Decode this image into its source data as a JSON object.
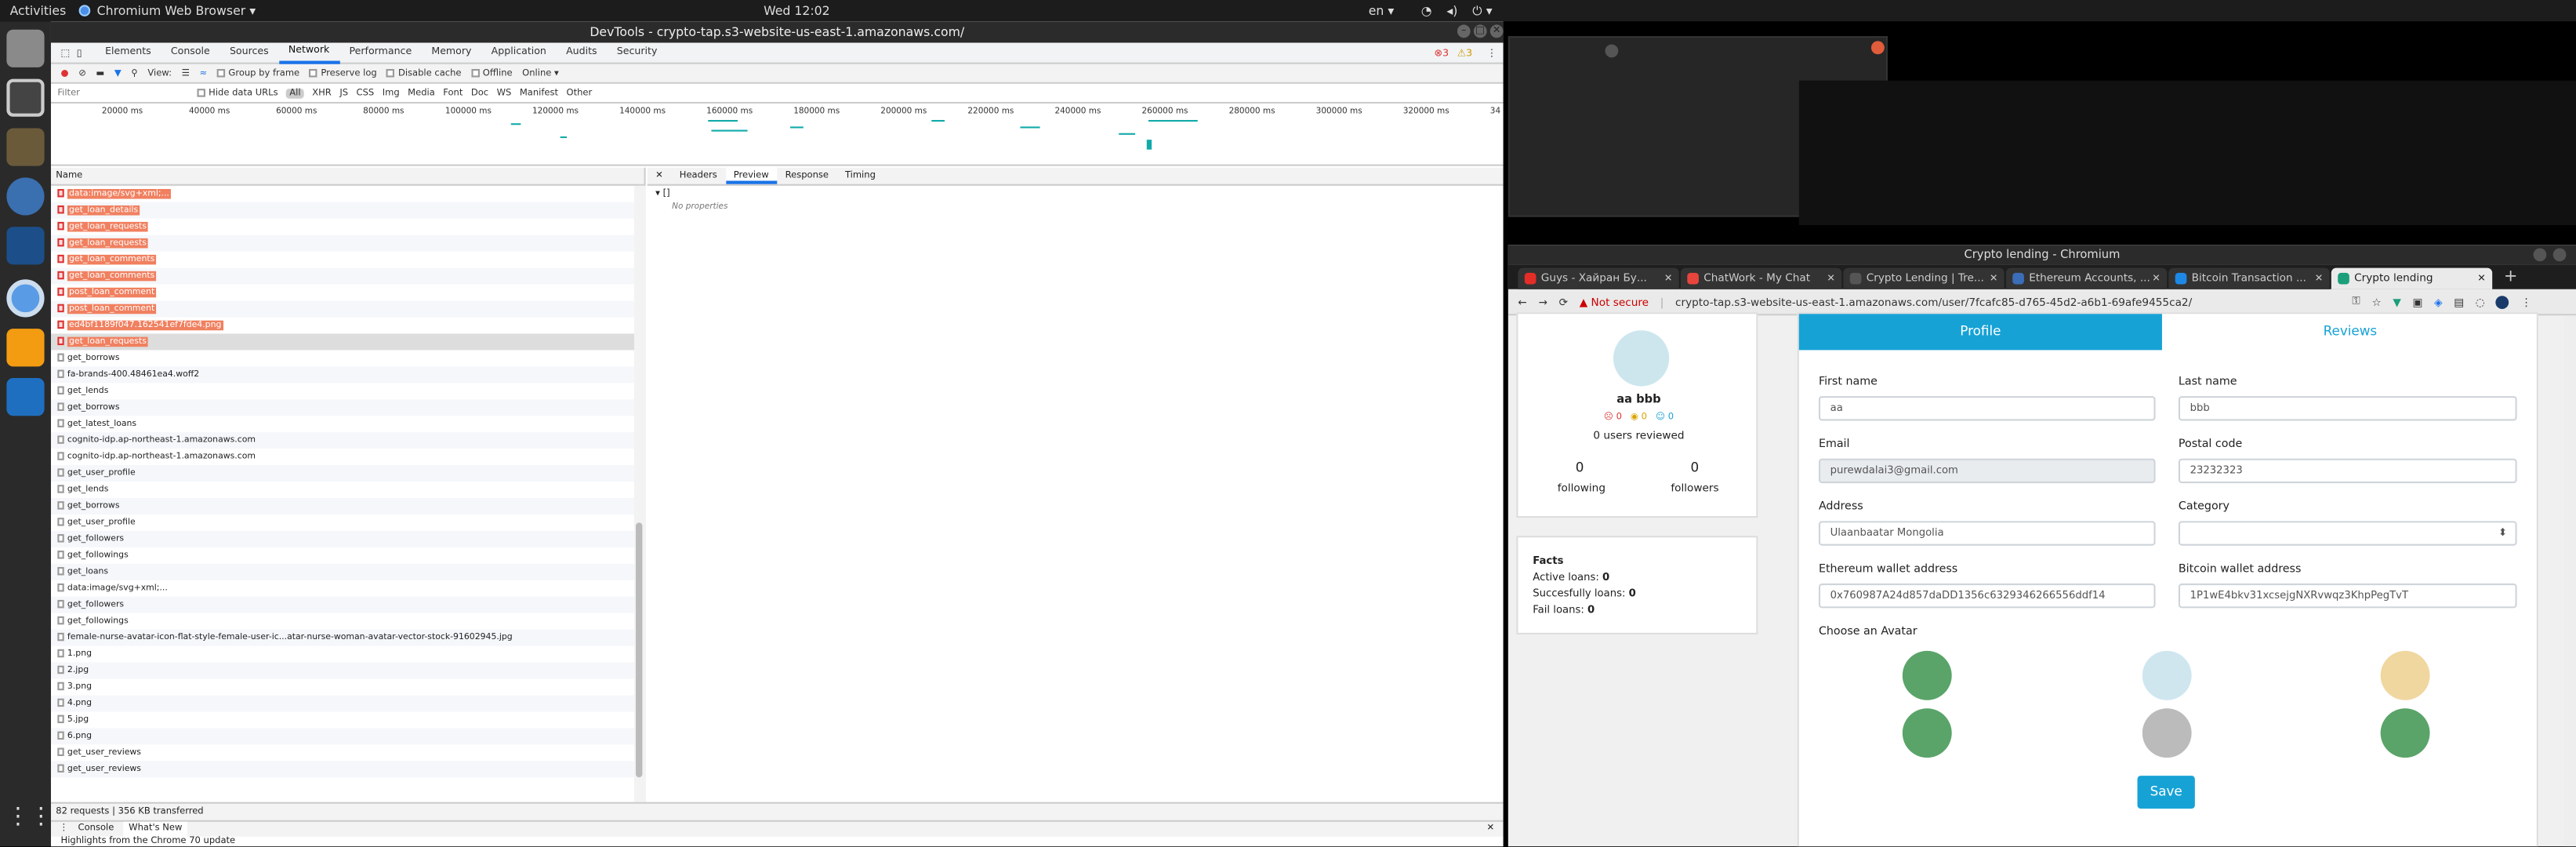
{
  "topbar": {
    "activities": "Activities",
    "app": "Chromium Web Browser ▾",
    "clock": "Wed 12:02",
    "lang": "en ▾"
  },
  "devtools": {
    "title": "DevTools - crypto-tap.s3-website-us-east-1.amazonaws.com/",
    "tabs": [
      "Elements",
      "Console",
      "Sources",
      "Network",
      "Performance",
      "Memory",
      "Application",
      "Audits",
      "Security"
    ],
    "active_tab": "Network",
    "errors": "3",
    "warnings": "3",
    "toolbar": {
      "view": "View:",
      "group": "Group by frame",
      "preserve": "Preserve log",
      "cache": "Disable cache",
      "offline": "Offline",
      "online": "Online"
    },
    "filter": {
      "placeholder": "Filter",
      "hide": "Hide data URLs",
      "types": [
        "All",
        "XHR",
        "JS",
        "CSS",
        "Img",
        "Media",
        "Font",
        "Doc",
        "WS",
        "Manifest",
        "Other"
      ]
    },
    "timeline_ticks": [
      "20000 ms",
      "40000 ms",
      "60000 ms",
      "80000 ms",
      "100000 ms",
      "120000 ms",
      "140000 ms",
      "160000 ms",
      "180000 ms",
      "200000 ms",
      "220000 ms",
      "240000 ms",
      "260000 ms",
      "280000 ms",
      "300000 ms",
      "320000 ms",
      "34"
    ],
    "name_header": "Name",
    "requests": [
      {
        "name": "data:image/svg+xml;...",
        "err": true
      },
      {
        "name": "get_loan_details",
        "err": true
      },
      {
        "name": "get_loan_requests",
        "err": true
      },
      {
        "name": "get_loan_requests",
        "err": true
      },
      {
        "name": "get_loan_comments",
        "err": true
      },
      {
        "name": "get_loan_comments",
        "err": true
      },
      {
        "name": "post_loan_comment",
        "err": true
      },
      {
        "name": "post_loan_comment",
        "err": true
      },
      {
        "name": "ed4bf1189f047.162541ef7fde4.png",
        "err": true
      },
      {
        "name": "get_loan_requests",
        "err": true,
        "sel": true
      },
      {
        "name": "get_borrows"
      },
      {
        "name": "fa-brands-400.48461ea4.woff2"
      },
      {
        "name": "get_lends"
      },
      {
        "name": "get_borrows"
      },
      {
        "name": "get_latest_loans"
      },
      {
        "name": "cognito-idp.ap-northeast-1.amazonaws.com"
      },
      {
        "name": "cognito-idp.ap-northeast-1.amazonaws.com"
      },
      {
        "name": "get_user_profile"
      },
      {
        "name": "get_lends"
      },
      {
        "name": "get_borrows"
      },
      {
        "name": "get_user_profile"
      },
      {
        "name": "get_followers"
      },
      {
        "name": "get_followings"
      },
      {
        "name": "get_loans"
      },
      {
        "name": "data:image/svg+xml;..."
      },
      {
        "name": "get_followers"
      },
      {
        "name": "get_followings"
      },
      {
        "name": "female-nurse-avatar-icon-flat-style-female-user-ic...atar-nurse-woman-avatar-vector-stock-91602945.jpg"
      },
      {
        "name": "1.png"
      },
      {
        "name": "2.jpg"
      },
      {
        "name": "3.png"
      },
      {
        "name": "4.png"
      },
      {
        "name": "5.jpg"
      },
      {
        "name": "6.png"
      },
      {
        "name": "get_user_reviews"
      },
      {
        "name": "get_user_reviews"
      }
    ],
    "preview_tabs": [
      "Headers",
      "Preview",
      "Response",
      "Timing"
    ],
    "preview_active": "Preview",
    "preview_root": "▾ []",
    "preview_empty": "No properties",
    "status": "82 requests  |  356 KB transferred",
    "drawer_tabs": [
      "Console",
      "What's New"
    ],
    "drawer_msg": "Highlights from the Chrome 70 update"
  },
  "browser": {
    "title": "Crypto lending - Chromium",
    "tabs": [
      {
        "label": "Guys - Хайран Бу...",
        "color": "#e52d27"
      },
      {
        "label": "ChatWork - My Chat",
        "color": "#e8453c"
      },
      {
        "label": "Crypto Lending | Tre...",
        "color": "#555"
      },
      {
        "label": "Ethereum Accounts, ...",
        "color": "#3c6db9"
      },
      {
        "label": "Bitcoin Transaction ...",
        "color": "#1e88e5"
      },
      {
        "label": "Crypto lending",
        "color": "#1a9f7a",
        "on": true
      }
    ],
    "not_secure": "Not secure",
    "url": "crypto-tap.s3-website-us-east-1.amazonaws.com/user/7fcafc85-d765-45d2-a6b1-69afe9455ca2/",
    "profile": {
      "name": "aa bbb",
      "neg": "0",
      "neu": "0",
      "pos": "0",
      "reviewed": "0 users reviewed",
      "following_count": "0",
      "following": "following",
      "followers_count": "0",
      "followers": "followers"
    },
    "facts": {
      "title": "Facts",
      "active_label": "Active loans:",
      "active": "0",
      "success_label": "Succesfully loans:",
      "success": "0",
      "fail_label": "Fail loans:",
      "fail": "0"
    },
    "form": {
      "tab_profile": "Profile",
      "tab_reviews": "Reviews",
      "first_name_label": "First name",
      "first_name": "aa",
      "last_name_label": "Last name",
      "last_name": "bbb",
      "email_label": "Email",
      "email": "purewdalai3@gmail.com",
      "postal_label": "Postal code",
      "postal": "23232323",
      "address_label": "Address",
      "address": "Ulaanbaatar Mongolia",
      "category_label": "Category",
      "category": "",
      "eth_label": "Ethereum wallet address",
      "eth": "0x760987A24d857daDD1356c6329346266556ddf14",
      "btc_label": "Bitcoin wallet address",
      "btc": "1P1wE4bkv31xcsejgNXRvwqz3KhpPegTvT",
      "avatar_label": "Choose an Avatar",
      "save": "Save"
    }
  },
  "colors": {
    "accent": "#17a2d6",
    "error": "#f08060",
    "devtools_blue": "#1a73e8"
  }
}
